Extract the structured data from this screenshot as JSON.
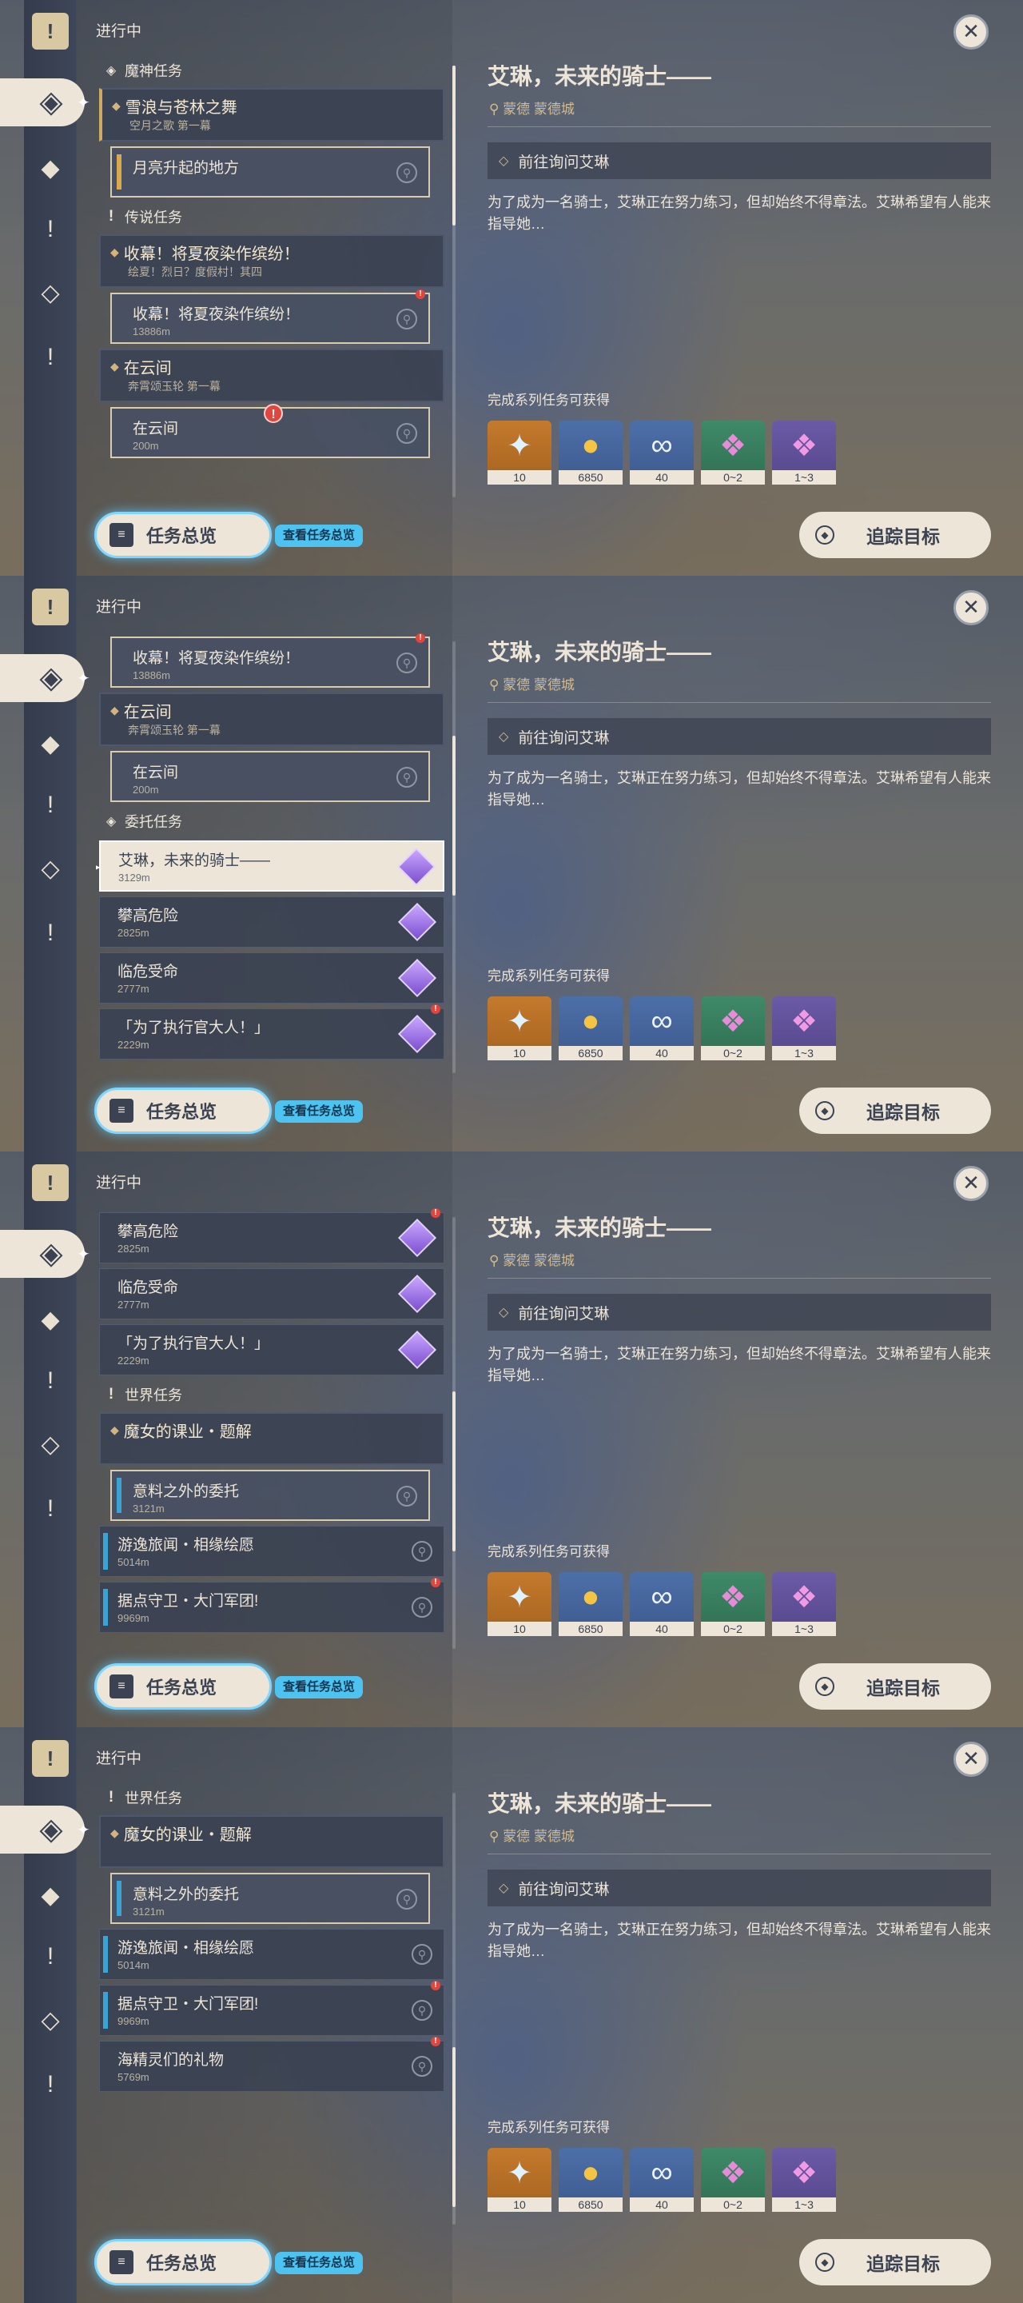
{
  "progress_label": "进行中",
  "detail": {
    "title": "艾琳，未来的骑士——",
    "location": "蒙德 蒙德城",
    "step": "前往询问艾琳",
    "description": "为了成为一名骑士，艾琳正在努力练习，但却始终不得章法。艾琳希望有人能来指导她…",
    "reward_label": "完成系列任务可获得",
    "rewards": [
      {
        "icon": "primogem-icon",
        "qty": "10"
      },
      {
        "icon": "mora-icon",
        "qty": "6850"
      },
      {
        "icon": "exp-icon",
        "qty": "40"
      },
      {
        "icon": "crystal-green-icon",
        "qty": "0~2"
      },
      {
        "icon": "crystal-purple-icon",
        "qty": "1~3"
      }
    ]
  },
  "buttons": {
    "overview": "任务总览",
    "overview_tip": "查看任务总览",
    "track": "追踪目标"
  },
  "categories": {
    "archon": "魔神任务",
    "story": "传说任务",
    "commission": "委托任务",
    "world": "世界任务"
  },
  "quests": {
    "q1": {
      "title": "雪浪与苍林之舞",
      "sub": "空月之歌 第一幕"
    },
    "q1s": {
      "title": "月亮升起的地方"
    },
    "q2": {
      "title": "收幕！将夏夜染作缤纷！",
      "sub": "绘夏！烈日？度假村！其四"
    },
    "q2s": {
      "title": "收幕！将夏夜染作缤纷！",
      "dist": "13886m"
    },
    "q3": {
      "title": "在云间",
      "sub": "奔霄颂玉轮 第一幕"
    },
    "q3s": {
      "title": "在云间",
      "dist": "200m"
    },
    "c1": {
      "title": "艾琳，未来的骑士——",
      "dist": "3129m"
    },
    "c2": {
      "title": "攀高危险",
      "dist": "2825m"
    },
    "c3": {
      "title": "临危受命",
      "dist": "2777m"
    },
    "c4": {
      "title": "「为了执行官大人！」",
      "dist": "2229m"
    },
    "w1": {
      "title": "魔女的课业・题解"
    },
    "w1s": {
      "title": "意料之外的委托",
      "dist": "3121m"
    },
    "w2": {
      "title": "游逸旅闻・相缘绘愿",
      "dist": "5014m"
    },
    "w3": {
      "title": "据点守卫・大门军团!",
      "dist": "9969m"
    },
    "w4": {
      "title": "海精灵们的礼物",
      "dist": "5769m"
    }
  },
  "colors": {
    "accent_gold": "#d3bc8e",
    "panel_dark": "#3b4252",
    "cream": "#ece5d8",
    "highlight_blue": "#4cc3f0"
  }
}
